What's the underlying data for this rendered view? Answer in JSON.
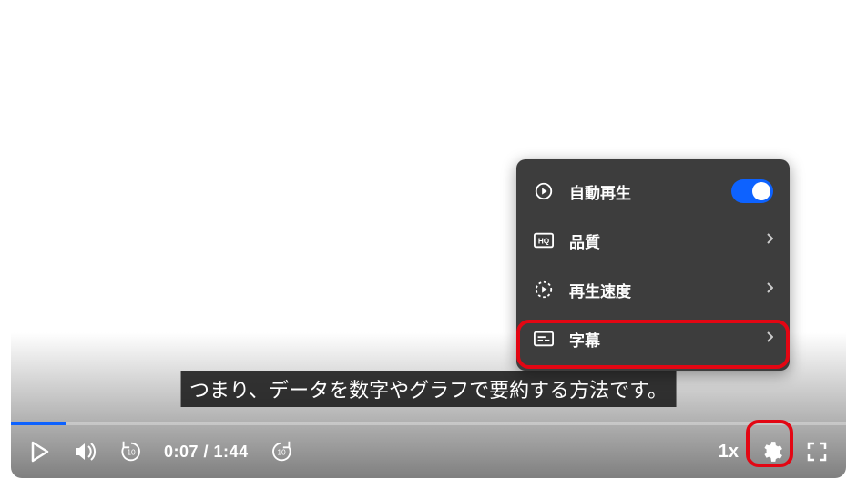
{
  "caption_text": "つまり、データを数字やグラフで要約する方法です。",
  "time": {
    "current": "0:07",
    "duration": "1:44",
    "separator": " / "
  },
  "speed_label": "1x",
  "menu": {
    "autoplay": {
      "label": "自動再生",
      "enabled": true
    },
    "quality": {
      "label": "品質"
    },
    "speed": {
      "label": "再生速度"
    },
    "subtitle": {
      "label": "字幕"
    }
  }
}
